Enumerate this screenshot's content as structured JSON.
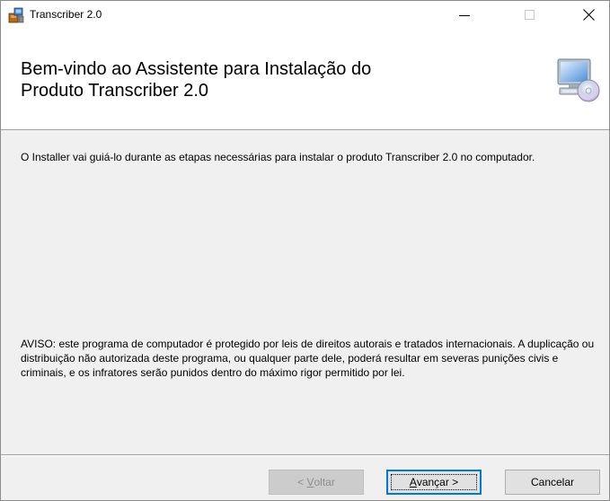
{
  "window": {
    "title": "Transcriber 2.0",
    "controls": {
      "minimize": "—",
      "maximize": "☐",
      "close": "✕"
    }
  },
  "header": {
    "title_line1": "Bem-vindo ao Assistente para Instalação do",
    "title_line2": "Produto Transcriber 2.0",
    "icon": "computer-cd-icon"
  },
  "content": {
    "intro": "O Installer vai guiá-lo durante as etapas necessárias para instalar o produto Transcriber 2.0 no computador.",
    "warning": "AVISO: este programa de computador é protegido por leis de direitos autorais e tratados internacionais. A duplicação ou distribuição não autorizada deste programa, ou qualquer parte dele, poderá resultar em severas punições civis e criminais, e os infratores serão punidos dentro do máximo rigor permitido por lei."
  },
  "buttons": {
    "back": {
      "prefix": "< ",
      "mnemonic": "V",
      "rest": "oltar",
      "enabled": false
    },
    "next": {
      "mnemonic": "A",
      "rest": "vançar >",
      "enabled": true
    },
    "cancel": {
      "label": "Cancelar",
      "enabled": true
    }
  },
  "colors": {
    "accent": "#0078d7",
    "window_bg": "#f0f0f0",
    "header_bg": "#ffffff"
  }
}
